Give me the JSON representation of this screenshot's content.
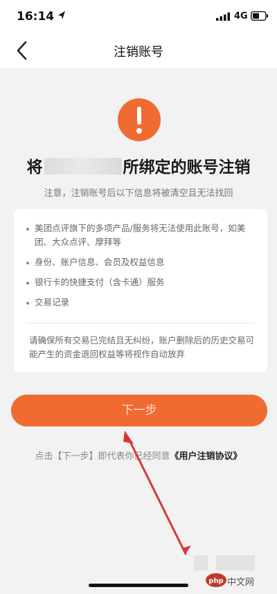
{
  "status_bar": {
    "time": "16:14",
    "network": "4G"
  },
  "nav": {
    "title": "注销账号"
  },
  "content": {
    "headline_prefix": "将",
    "headline_suffix": "所绑定的账号注销",
    "subnote": "注意，注销账号后以下信息将被清空且无法找回",
    "items": [
      "美团点评旗下的多项产品/服务将无法使用此账号，如美团、大众点评、摩拜等",
      "身份、账户信息、会员及权益信息",
      "银行卡的快捷支付（含卡通）服务",
      "交易记录"
    ],
    "warning": "请确保所有交易已完结且无纠纷，账户删除后的历史交易可能产生的资金退回权益等将视作自动放弃"
  },
  "actions": {
    "next_label": "下一步",
    "agreement_prefix": "点击【下一步】即代表你已经同意",
    "agreement_link": "《用户注销协议》"
  },
  "watermark": {
    "text": "中文网",
    "logo_text": "php"
  },
  "colors": {
    "accent": "#f06b32",
    "background": "#f2f2f2",
    "annotation_arrow": "#d9343a"
  }
}
